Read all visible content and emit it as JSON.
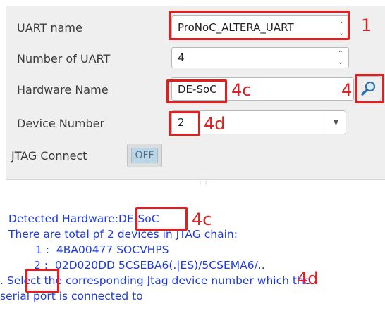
{
  "form": {
    "uart_name_label": "UART name",
    "uart_name_value": "ProNoC_ALTERA_UART",
    "num_uart_label": "Number of UART",
    "num_uart_value": "4",
    "hardware_name_label": "Hardware Name",
    "hardware_name_value": "DE-SoC",
    "device_number_label": "Device Number",
    "device_number_value": "2",
    "jtag_connect_label": "JTAG Connect",
    "jtag_connect_state": "OFF"
  },
  "log": {
    "detected_prefix": "Detected Hardware:",
    "detected_value": "DE-SoC",
    "line2": "There are total pf 2 devices in JTAG chain:",
    "device1_index": "1 :",
    "device1_text": "4BA00477   SOCVHPS",
    "device2_index": "2 :",
    "device2_text": "02D020DD   5CSEBA6(.|ES)/5CSEMA6/..",
    "line5": ". Select the corresponding Jtag device number which the",
    "line6": "serial port is connected to"
  },
  "annotations": {
    "a1": "1",
    "a4": "4",
    "a4c_top": "4c",
    "a4d_top": "4d",
    "a4c_log": "4c",
    "a4d_log": "4d"
  },
  "icons": {
    "search": "magnifier-icon",
    "spin": "up-down-arrows-icon",
    "dropdown": "chevron-down-icon"
  },
  "colors": {
    "annotation": "#e02020",
    "log_text": "#1f3bd6",
    "toggle_face": "#bcd6e6"
  }
}
